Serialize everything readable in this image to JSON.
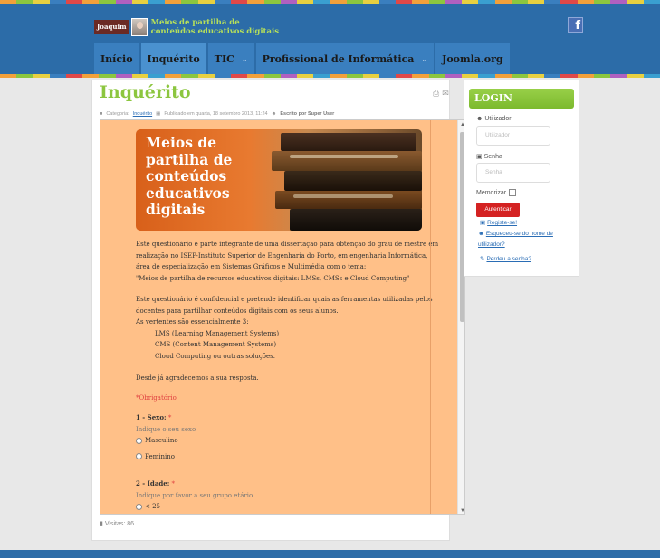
{
  "header": {
    "logo_name": "Joaquim",
    "logo_line1": "Meios de partilha de",
    "logo_line2": "conteúdos educativos digitais"
  },
  "menu": {
    "items": [
      {
        "label": "Início"
      },
      {
        "label": "Inquérito"
      },
      {
        "label": "TIC"
      },
      {
        "label": "Profissional de Informática"
      },
      {
        "label": "Joomla.org"
      }
    ]
  },
  "article": {
    "title": "Inquérito",
    "category_prefix": "Categoria:",
    "category_link": "Inquérito",
    "published": "Publicado em quarta, 18 setembro 2013, 11:24",
    "author": "Escrito por Super User"
  },
  "form": {
    "banner_lines": [
      "Meios de",
      "partilha de",
      "conteúdos",
      "educativos",
      "digitais"
    ],
    "intro_lines": [
      "Este questionário é parte integrante de uma dissertação para obtenção do grau de mestre em",
      "realização no ISEP-Instituto Superior de Engenharia do Porto, em engenharia Informática,",
      "área de especialização em Sistemas Gráficos e Multimédia com o tema:",
      "\"Meios de partilha de recursos educativos digitais: LMSs, CMSs e Cloud Computing\""
    ],
    "purpose_lines": [
      "Este questionário é confidencial e pretende identificar quais as ferramentas utilizadas pelos",
      "docentes para partilhar conteúdos digitais com os seus alunos.",
      "As vertentes são essencialmente 3:"
    ],
    "aspects": [
      "LMS (Learning Management Systems)",
      "CMS (Content Management Systems)",
      "Cloud Computing ou outras soluções."
    ],
    "thanks": "Desde já agradecemos a sua resposta.",
    "required_note": "*Obrigatório",
    "q1_label": "1 - Sexo:",
    "q1_help": "Indique o seu sexo",
    "q1_options": [
      "Masculino",
      "Feminino"
    ],
    "q2_label": "2 - Idade:",
    "q2_help": "Indique por favor a seu grupo etário",
    "q2_options": [
      "< 25"
    ],
    "asterisk": "*"
  },
  "visits": "Visitas: 86",
  "login": {
    "title": "LOGIN",
    "user_label": "Utilizador",
    "user_placeholder": "Utilizador",
    "pass_label": "Senha",
    "pass_placeholder": "Senha",
    "remember_label": "Memorizar",
    "submit": "Autenticar",
    "register": "Registe-se!",
    "forgot_user_line1": "Esqueceu-se do nome de",
    "forgot_user_line2": "utilizador?",
    "forgot_pass": "Perdeu a senha?"
  },
  "colors": {
    "header_blue": "#2c6ca8",
    "title_green": "#8cc63f",
    "form_bg": "#ffc088",
    "submit_red": "#d42222"
  },
  "icons": [
    "facebook-icon",
    "print-icon",
    "email-icon",
    "folder-icon",
    "calendar-icon",
    "user-icon",
    "lock-icon",
    "stats-icon",
    "chevron-down-icon",
    "edit-icon"
  ]
}
